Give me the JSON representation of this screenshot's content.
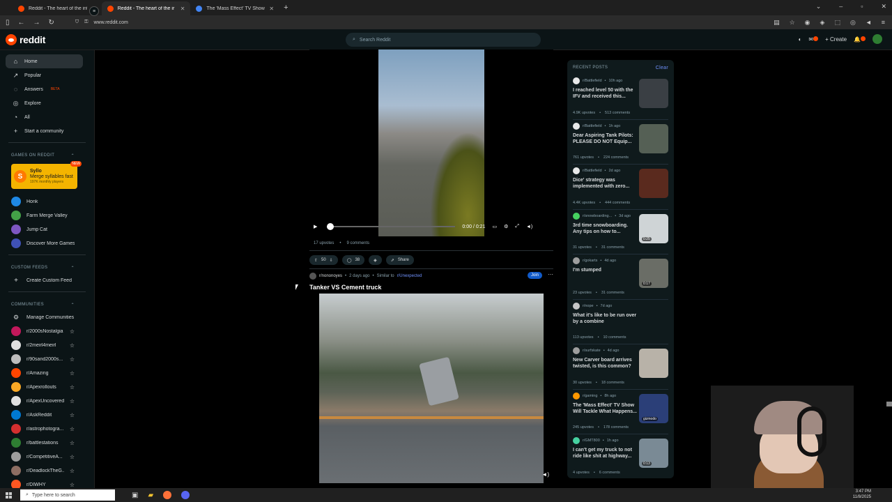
{
  "browser": {
    "tabs": [
      {
        "title": "Reddit - The heart of the interne",
        "active": false
      },
      {
        "title": "Reddit - The heart of the ir",
        "active": true
      },
      {
        "title": "The 'Mass Effect' TV Show Will",
        "active": false
      }
    ],
    "url": "www.reddit.com"
  },
  "header": {
    "logo_text": "reddit",
    "search_placeholder": "Search Reddit",
    "create_label": "Create",
    "chat_badge": "1",
    "notif_badge": "1"
  },
  "sidebar": {
    "nav": [
      {
        "label": "Home",
        "icon": "home-icon",
        "active": true
      },
      {
        "label": "Popular",
        "icon": "popular-icon"
      },
      {
        "label": "Answers",
        "icon": "answers-icon",
        "badge": "BETA"
      },
      {
        "label": "Explore",
        "icon": "explore-icon"
      },
      {
        "label": "All",
        "icon": "all-icon"
      },
      {
        "label": "Start a community",
        "icon": "plus-icon"
      }
    ],
    "games_header": "GAMES ON REDDIT",
    "featured_game": {
      "name": "Syllo",
      "tagline": "Merge syllables fast",
      "players": "197K monthly players",
      "badge": "NEW"
    },
    "games": [
      "Honk",
      "Farm Merge Valley",
      "Jump Cat",
      "Discover More Games"
    ],
    "custom_feeds_header": "CUSTOM FEEDS",
    "create_custom_feed": "Create Custom Feed",
    "communities_header": "COMMUNITIES",
    "manage_communities": "Manage Communities",
    "communities": [
      {
        "name": "r/2000sNostalgia",
        "color": "#c2185b"
      },
      {
        "name": "r/2meirl4meirl",
        "color": "#e0e0e0"
      },
      {
        "name": "r/90sand2000s...",
        "color": "#bdbdbd"
      },
      {
        "name": "r/Amazing",
        "color": "#ff4500"
      },
      {
        "name": "r/Apexrollouts",
        "color": "#f9a825"
      },
      {
        "name": "r/ApexUncovered",
        "color": "#e0e0e0"
      },
      {
        "name": "r/AskReddit",
        "color": "#0079d3"
      },
      {
        "name": "r/astrophotogra...",
        "color": "#d32f2f"
      },
      {
        "name": "r/battlestations",
        "color": "#2e7d32"
      },
      {
        "name": "r/CompetitiveA...",
        "color": "#9e9e9e"
      },
      {
        "name": "r/DeadlockTheG...",
        "color": "#8d6e63"
      },
      {
        "name": "r/DIWHY",
        "color": "#ff5722"
      }
    ]
  },
  "feed": {
    "video1": {
      "time": "0:00 / 0:21",
      "upvotes_text": "17 upvotes",
      "comments_text": "9 comments"
    },
    "actions": {
      "votes": "50",
      "comments": "38",
      "share": "Share"
    },
    "post2": {
      "subreddit": "r/nononoyes",
      "age": "2 days ago",
      "similar_prefix": "Similar to",
      "similar_sub": "r/Unexpected",
      "join": "Join",
      "title": "Tanker VS Cement truck"
    }
  },
  "recent": {
    "header": "RECENT POSTS",
    "clear": "Clear",
    "posts": [
      {
        "sub": "r/Battlefield",
        "age": "10h ago",
        "title": "I reached level 50 with the IFV and received this...",
        "upvotes": "4.9K upvotes",
        "comments": "513 comments",
        "thumb": "#3a3f44",
        "avatar": "#e8e8e8",
        "duration": ""
      },
      {
        "sub": "r/Battlefield",
        "age": "1h ago",
        "title": "Dear Aspiring Tank Pilots: PLEASE DO NOT Equip...",
        "upvotes": "761 upvotes",
        "comments": "224 comments",
        "thumb": "#556055",
        "avatar": "#e8e8e8",
        "duration": ""
      },
      {
        "sub": "r/Battlefield",
        "age": "2d ago",
        "title": "Dice' strategy was implemented with zero...",
        "upvotes": "4.4K upvotes",
        "comments": "444 comments",
        "thumb": "#5a2a1e",
        "avatar": "#e8e8e8",
        "duration": ""
      },
      {
        "sub": "r/snowboarding...",
        "age": "3d ago",
        "title": "3rd time snowboarding. Any tips on how to...",
        "upvotes": "31 upvotes",
        "comments": "31 comments",
        "thumb": "#cfd4d6",
        "avatar": "#46d160",
        "duration": "0:25"
      },
      {
        "sub": "r/gokarts",
        "age": "4d ago",
        "title": "I'm stumped",
        "upvotes": "23 upvotes",
        "comments": "31 comments",
        "thumb": "#6a6d66",
        "avatar": "#9e9e9e",
        "duration": "0:17"
      },
      {
        "sub": "r/nope",
        "age": "7d ago",
        "title": "What it's like to be run over by a combine",
        "upvotes": "113 upvotes",
        "comments": "10 comments",
        "thumb": "",
        "avatar": "#c5c5c5",
        "duration": ""
      },
      {
        "sub": "r/surfskate",
        "age": "4d ago",
        "title": "New Carver board arrives twisted, is this common?",
        "upvotes": "30 upvotes",
        "comments": "18 comments",
        "thumb": "#b8b2a8",
        "avatar": "#9e9e9e",
        "duration": ""
      },
      {
        "sub": "r/gaming",
        "age": "8h ago",
        "title": "The 'Mass Effect' TV Show Will Tackle What Happens...",
        "upvotes": "245 upvotes",
        "comments": "178 comments",
        "thumb": "#2b3f78",
        "avatar": "#ff9800",
        "duration": "gizmodo"
      },
      {
        "sub": "r/GMT800",
        "age": "1h ago",
        "title": "I can't get my truck to not ride like shit at highway...",
        "upvotes": "4 upvotes",
        "comments": "6 comments",
        "thumb": "#7a8a95",
        "avatar": "#46d1a0",
        "duration": "0:13"
      }
    ]
  },
  "taskbar": {
    "search_placeholder": "Type here to search",
    "time": "3:47 PM",
    "date": "11/8/2025"
  }
}
